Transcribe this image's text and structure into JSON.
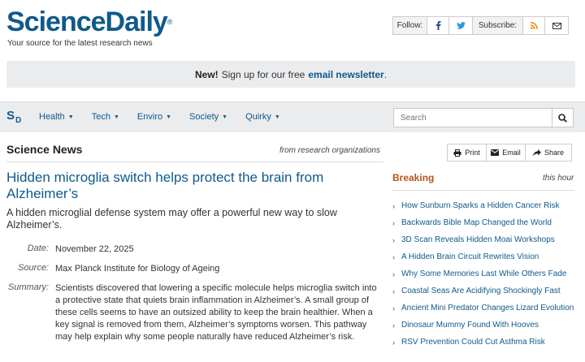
{
  "header": {
    "logo_text": "ScienceDaily",
    "logo_mark": "®",
    "tagline": "Your source for the latest research news",
    "follow_label": "Follow:",
    "subscribe_label": "Subscribe:"
  },
  "banner": {
    "prefix": "New!",
    "text": "Sign up for our free",
    "link": "email newsletter",
    "suffix": "."
  },
  "nav": {
    "logo_s": "S",
    "logo_d": "D",
    "items": [
      {
        "label": "Health"
      },
      {
        "label": "Tech"
      },
      {
        "label": "Enviro"
      },
      {
        "label": "Society"
      },
      {
        "label": "Quirky"
      }
    ],
    "search_placeholder": "Search"
  },
  "main": {
    "section_title": "Science News",
    "from_orgs": "from research organizations",
    "headline": "Hidden microglia switch helps protect the brain from Alzheimer’s",
    "subheadline": "A hidden microglial defense system may offer a powerful new way to slow Alzheimer’s.",
    "date_label": "Date:",
    "date_value": "November 22, 2025",
    "source_label": "Source:",
    "source_value": "Max Planck Institute for Biology of Ageing",
    "summary_label": "Summary:",
    "summary_value": "Scientists discovered that lowering a specific molecule helps microglia switch into a protective state that quiets brain inflammation in Alzheimer’s. A small group of these cells seems to have an outsized ability to keep the brain healthier. When a key signal is removed from them, Alzheimer’s symptoms worsen. This pathway may help explain why some people naturally have reduced Alzheimer’s risk."
  },
  "share": {
    "print_label": "Print",
    "email_label": "Email",
    "share_label": "Share"
  },
  "breaking": {
    "title": "Breaking",
    "subtitle": "this hour",
    "items": [
      "How Sunburn Sparks a Hidden Cancer Risk",
      "Backwards Bible Map Changed the World",
      "3D Scan Reveals Hidden Moai Workshops",
      "A Hidden Brain Circuit Rewrites Vision",
      "Why Some Memories Last While Others Fade",
      "Coastal Seas Are Acidifying Shockingly Fast",
      "Ancient Mini Predator Changes Lizard Evolution",
      "Dinosaur Mummy Found With Hooves",
      "RSV Prevention Could Cut Asthma Risk"
    ]
  },
  "colors": {
    "brand": "#0f5a8a",
    "breaking": "#b1551a"
  }
}
